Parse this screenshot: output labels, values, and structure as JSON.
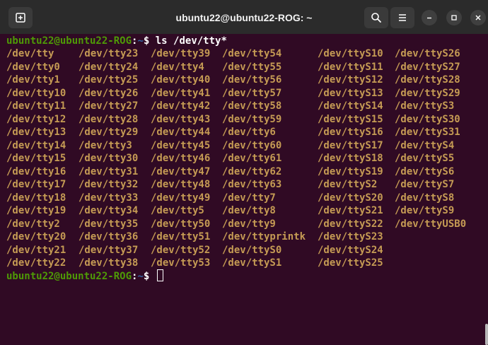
{
  "window": {
    "title": "ubuntu22@ubuntu22-ROG: ~"
  },
  "colors": {
    "background": "#300a24",
    "prompt_user": "#4e9a06",
    "prompt_path": "#3465a4",
    "device_files": "#c59b54"
  },
  "icons": {
    "new_tab": "new-tab-icon",
    "search": "search-icon",
    "menu": "hamburger-menu-icon",
    "minimize": "minimize-icon",
    "maximize": "maximize-icon",
    "close": "close-icon"
  },
  "prompt1": {
    "user_host": "ubuntu22@ubuntu22-ROG",
    "sep": ":",
    "path": "~",
    "dollar": "$ ",
    "command": "ls /dev/tty*"
  },
  "prompt2": {
    "user_host": "ubuntu22@ubuntu22-ROG",
    "sep": ":",
    "path": "~",
    "dollar": "$ "
  },
  "ls_output": {
    "columns": [
      [
        "/dev/tty",
        "/dev/tty0",
        "/dev/tty1",
        "/dev/tty10",
        "/dev/tty11",
        "/dev/tty12",
        "/dev/tty13",
        "/dev/tty14",
        "/dev/tty15",
        "/dev/tty16",
        "/dev/tty17",
        "/dev/tty18",
        "/dev/tty19",
        "/dev/tty2",
        "/dev/tty20",
        "/dev/tty21",
        "/dev/tty22"
      ],
      [
        "/dev/tty23",
        "/dev/tty24",
        "/dev/tty25",
        "/dev/tty26",
        "/dev/tty27",
        "/dev/tty28",
        "/dev/tty29",
        "/dev/tty3",
        "/dev/tty30",
        "/dev/tty31",
        "/dev/tty32",
        "/dev/tty33",
        "/dev/tty34",
        "/dev/tty35",
        "/dev/tty36",
        "/dev/tty37",
        "/dev/tty38"
      ],
      [
        "/dev/tty39",
        "/dev/tty4",
        "/dev/tty40",
        "/dev/tty41",
        "/dev/tty42",
        "/dev/tty43",
        "/dev/tty44",
        "/dev/tty45",
        "/dev/tty46",
        "/dev/tty47",
        "/dev/tty48",
        "/dev/tty49",
        "/dev/tty5",
        "/dev/tty50",
        "/dev/tty51",
        "/dev/tty52",
        "/dev/tty53"
      ],
      [
        "/dev/tty54",
        "/dev/tty55",
        "/dev/tty56",
        "/dev/tty57",
        "/dev/tty58",
        "/dev/tty59",
        "/dev/tty6",
        "/dev/tty60",
        "/dev/tty61",
        "/dev/tty62",
        "/dev/tty63",
        "/dev/tty7",
        "/dev/tty8",
        "/dev/tty9",
        "/dev/ttyprintk",
        "/dev/ttyS0",
        "/dev/ttyS1"
      ],
      [
        "/dev/ttyS10",
        "/dev/ttyS11",
        "/dev/ttyS12",
        "/dev/ttyS13",
        "/dev/ttyS14",
        "/dev/ttyS15",
        "/dev/ttyS16",
        "/dev/ttyS17",
        "/dev/ttyS18",
        "/dev/ttyS19",
        "/dev/ttyS2",
        "/dev/ttyS20",
        "/dev/ttyS21",
        "/dev/ttyS22",
        "/dev/ttyS23",
        "/dev/ttyS24",
        "/dev/ttyS25"
      ],
      [
        "/dev/ttyS26",
        "/dev/ttyS27",
        "/dev/ttyS28",
        "/dev/ttyS29",
        "/dev/ttyS3",
        "/dev/ttyS30",
        "/dev/ttyS31",
        "/dev/ttyS4",
        "/dev/ttyS5",
        "/dev/ttyS6",
        "/dev/ttyS7",
        "/dev/ttyS8",
        "/dev/ttyS9",
        "/dev/ttyUSB0"
      ]
    ]
  }
}
